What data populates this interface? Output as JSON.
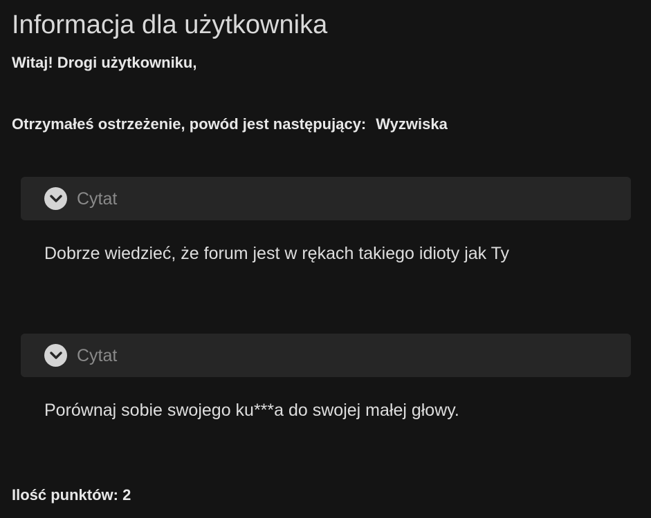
{
  "title": "Informacja dla użytkownika",
  "greeting": "Witaj! Drogi użytkowniku,",
  "warning": {
    "text": "Otrzymałeś ostrzeżenie, powód jest następujący:",
    "reason": "Wyzwiska"
  },
  "quotes": [
    {
      "label": "Cytat",
      "icon": "chevron-down-icon",
      "text": "Dobrze wiedzieć, że forum jest w rękach takiego idioty jak Ty"
    },
    {
      "label": "Cytat",
      "icon": "chevron-down-icon",
      "text": "Porównaj sobie swojego ku***a do swojej małej głowy."
    }
  ],
  "points": "Ilość punktów: 2",
  "colors": {
    "background": "#141414",
    "quote_header": "#262626",
    "text": "#e6e6e6",
    "muted": "#8a8a8a"
  }
}
